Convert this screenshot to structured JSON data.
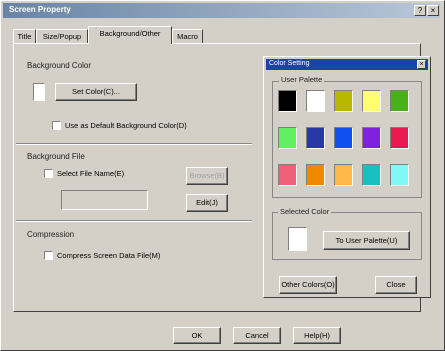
{
  "dialog": {
    "title": "Screen Property",
    "close_glyph": "×",
    "help_glyph": "?"
  },
  "tabs": [
    {
      "label": "Title"
    },
    {
      "label": "Size/Popup"
    },
    {
      "label": "Background/Other"
    },
    {
      "label": "Macro"
    }
  ],
  "background_color": {
    "group_label": "Background Color",
    "set_color_label": "Set Color(C)...",
    "use_default_label": "Use as Default Background Color(D)"
  },
  "background_file": {
    "group_label": "Background File",
    "select_file_label": "Select File Name(E)",
    "browse_label": "Browse(B)",
    "edit_label": "Edit(J)",
    "file_name_value": ""
  },
  "compression": {
    "group_label": "Compression",
    "compress_label": "Compress Screen Data File(M)"
  },
  "footer": {
    "ok_label": "OK",
    "cancel_label": "Cancel",
    "help_label": "Help(H)"
  },
  "color_setting": {
    "title": "Color Setting",
    "close_glyph": "×",
    "palette_label": "User Palette",
    "palette": [
      [
        "#000000",
        "#ffffff",
        "#b8b800",
        "#ffff70",
        "#48b018"
      ],
      [
        "#60f060",
        "#2838a8",
        "#1050f0",
        "#8020e0",
        "#e81850"
      ],
      [
        "#f06078",
        "#f08800",
        "#ffb848",
        "#18c0c0",
        "#80f8f8"
      ]
    ],
    "selected_label": "Selected Color",
    "selected_color": "#ffffff",
    "to_user_palette_label": "To User Palette(U)",
    "other_colors_label": "Other Colors(O)",
    "close_label": "Close"
  }
}
